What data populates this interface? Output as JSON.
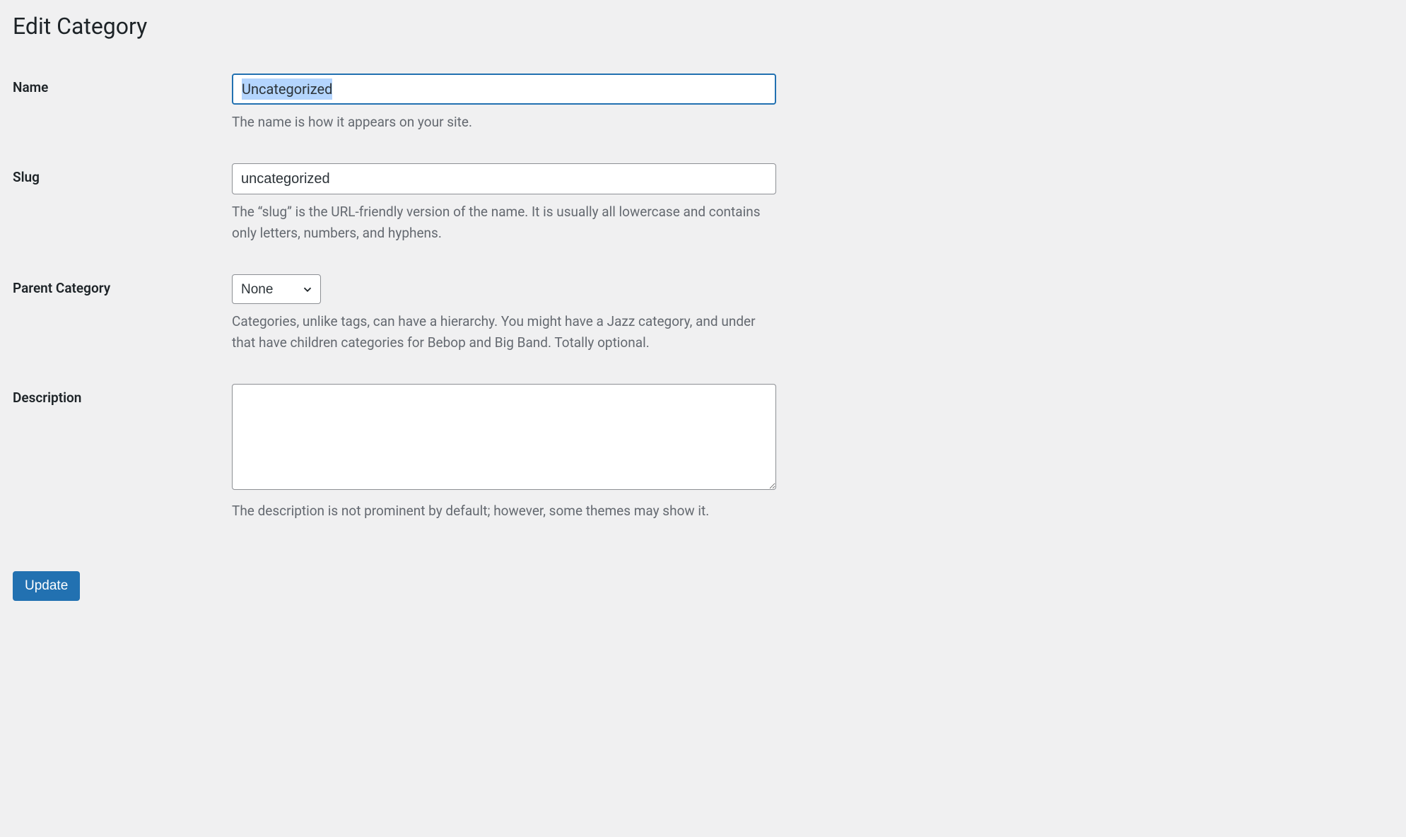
{
  "page": {
    "title": "Edit Category"
  },
  "fields": {
    "name": {
      "label": "Name",
      "value": "Uncategorized",
      "help": "The name is how it appears on your site."
    },
    "slug": {
      "label": "Slug",
      "value": "uncategorized",
      "help": "The “slug” is the URL-friendly version of the name. It is usually all lowercase and contains only letters, numbers, and hyphens."
    },
    "parent": {
      "label": "Parent Category",
      "value": "None",
      "help": "Categories, unlike tags, can have a hierarchy. You might have a Jazz category, and under that have children categories for Bebop and Big Band. Totally optional."
    },
    "description": {
      "label": "Description",
      "value": "",
      "help": "The description is not prominent by default; however, some themes may show it."
    }
  },
  "actions": {
    "submit_label": "Update"
  }
}
